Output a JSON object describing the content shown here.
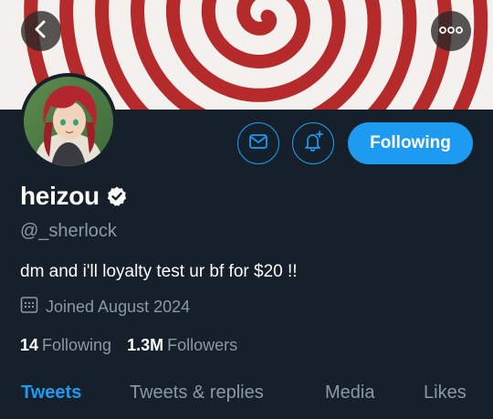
{
  "header": {
    "back_icon": "chevron-left-icon",
    "more_icon": "more-dots-icon"
  },
  "banner": {
    "description_colors": {
      "red": "#b52a2a",
      "white": "#f4f0ee"
    }
  },
  "profile": {
    "display_name": "heizou",
    "handle": "@_sherlock",
    "bio": "dm and i'll loyalty test ur bf for $20 !!",
    "joined": "Joined August 2024",
    "following_count": "14",
    "following_label": "Following",
    "followers_count": "1.3M",
    "followers_label": "Followers"
  },
  "actions": {
    "follow_label": "Following",
    "message_icon": "mail-icon",
    "notify_icon": "bell-plus-icon"
  },
  "tabs": [
    {
      "label": "Tweets",
      "active": true
    },
    {
      "label": "Tweets & replies",
      "active": false
    },
    {
      "label": "Media",
      "active": false
    },
    {
      "label": "Likes",
      "active": false
    }
  ],
  "colors": {
    "background": "#15202b",
    "accent": "#1d9bf0",
    "secondary_text": "#8b98a5"
  }
}
